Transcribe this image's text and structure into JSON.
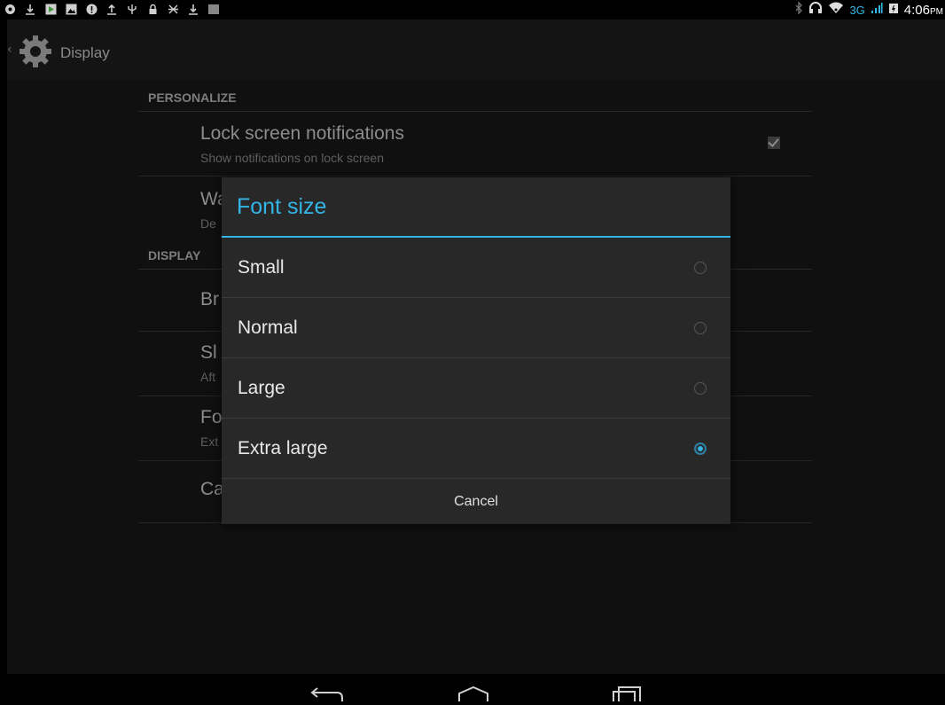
{
  "status_bar": {
    "network_type": "3G",
    "time": "4:06",
    "ampm": "PM"
  },
  "action_bar": {
    "title": "Display",
    "icon": "gear-icon"
  },
  "settings": {
    "sections": [
      {
        "header": "PERSONALIZE"
      },
      {
        "header": "DISPLAY"
      }
    ],
    "rows": [
      {
        "title": "Lock screen notifications",
        "summary": "Show notifications on lock screen",
        "checked": true
      },
      {
        "title": "Wa",
        "summary": "De"
      },
      {
        "title": "Br",
        "summary": ""
      },
      {
        "title": "Sl",
        "summary": "Aft"
      },
      {
        "title": "Fo",
        "summary": "Ext"
      },
      {
        "title": "Ca",
        "summary": ""
      }
    ]
  },
  "dialog": {
    "title": "Font size",
    "options": [
      {
        "label": "Small",
        "selected": false
      },
      {
        "label": "Normal",
        "selected": false
      },
      {
        "label": "Large",
        "selected": false
      },
      {
        "label": "Extra large",
        "selected": true
      }
    ],
    "cancel_label": "Cancel"
  },
  "colors": {
    "accent": "#33b5e5",
    "dialog_bg": "#282828",
    "scrim_bg": "#101010"
  }
}
